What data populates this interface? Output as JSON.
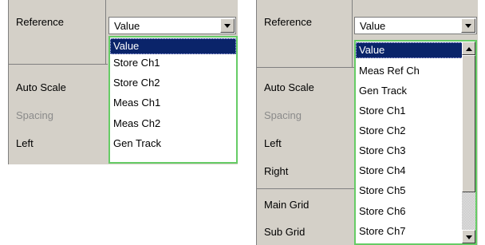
{
  "left": {
    "labels": {
      "reference": "Reference",
      "auto_scale": "Auto Scale",
      "spacing": "Spacing",
      "left": "Left"
    },
    "combo_value": "Value",
    "items": [
      "Value",
      "Store Ch1",
      "Store Ch2",
      "Meas Ch1",
      "Meas Ch2",
      "Gen Track"
    ],
    "selected_index": 0
  },
  "right": {
    "labels": {
      "reference": "Reference",
      "auto_scale": "Auto Scale",
      "spacing": "Spacing",
      "left": "Left",
      "right": "Right",
      "main_grid": "Main Grid",
      "sub_grid": "Sub Grid"
    },
    "combo_value": "Value",
    "items": [
      "Value",
      "Meas Ref Ch",
      "Gen Track",
      "Store Ch1",
      "Store Ch2",
      "Store Ch3",
      "Store Ch4",
      "Store Ch5",
      "Store Ch6",
      "Store Ch7"
    ],
    "selected_index": 0
  },
  "icons": {
    "dropdown": "chevron-down-icon",
    "scroll_up": "chevron-up-icon",
    "scroll_down": "chevron-down-icon"
  },
  "colors": {
    "panel_bg": "#d4d0c8",
    "selection_bg": "#0a246a",
    "list_border": "#66cc66"
  }
}
